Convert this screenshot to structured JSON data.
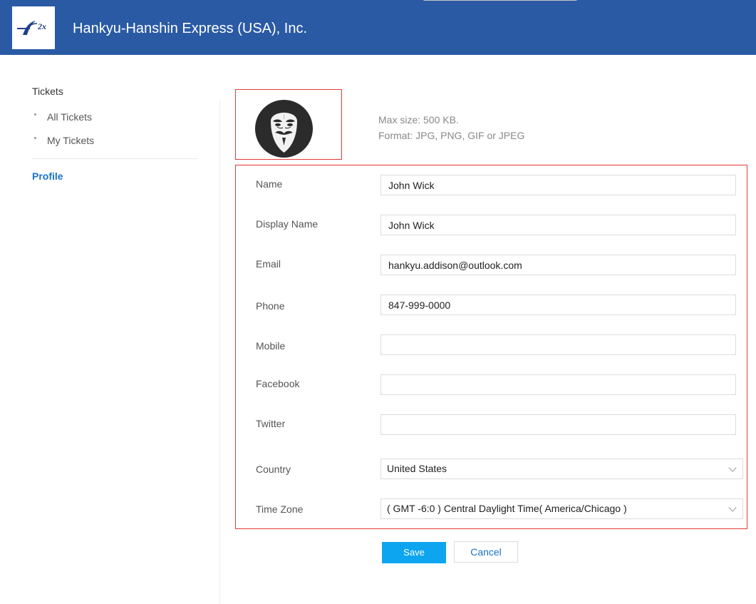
{
  "header": {
    "company": "Hankyu-Hanshin Express (USA), Inc.",
    "logo_text": "2x"
  },
  "sidebar": {
    "section": "Tickets",
    "items": [
      {
        "label": "All Tickets"
      },
      {
        "label": "My Tickets"
      }
    ],
    "profile_label": "Profile"
  },
  "avatar": {
    "hint_size": "Max size: 500 KB.",
    "hint_format": "Format: JPG, PNG, GIF or JPEG"
  },
  "form": {
    "name": {
      "label": "Name",
      "value": "John Wick"
    },
    "display_name": {
      "label": "Display Name",
      "value": "John Wick"
    },
    "email": {
      "label": "Email",
      "value": "hankyu.addison@outlook.com"
    },
    "phone": {
      "label": "Phone",
      "value": "847-999-0000"
    },
    "mobile": {
      "label": "Mobile",
      "value": ""
    },
    "facebook": {
      "label": "Facebook",
      "value": ""
    },
    "twitter": {
      "label": "Twitter",
      "value": ""
    },
    "country": {
      "label": "Country",
      "value": "United States"
    },
    "timezone": {
      "label": "Time Zone",
      "value": "( GMT -6:0 ) Central Daylight Time( America/Chicago )"
    }
  },
  "buttons": {
    "save": "Save",
    "cancel": "Cancel"
  },
  "colors": {
    "header": "#2a5aa4",
    "accent": "#0ea5f0",
    "link": "#1a73c8",
    "highlight": "#e53935"
  }
}
